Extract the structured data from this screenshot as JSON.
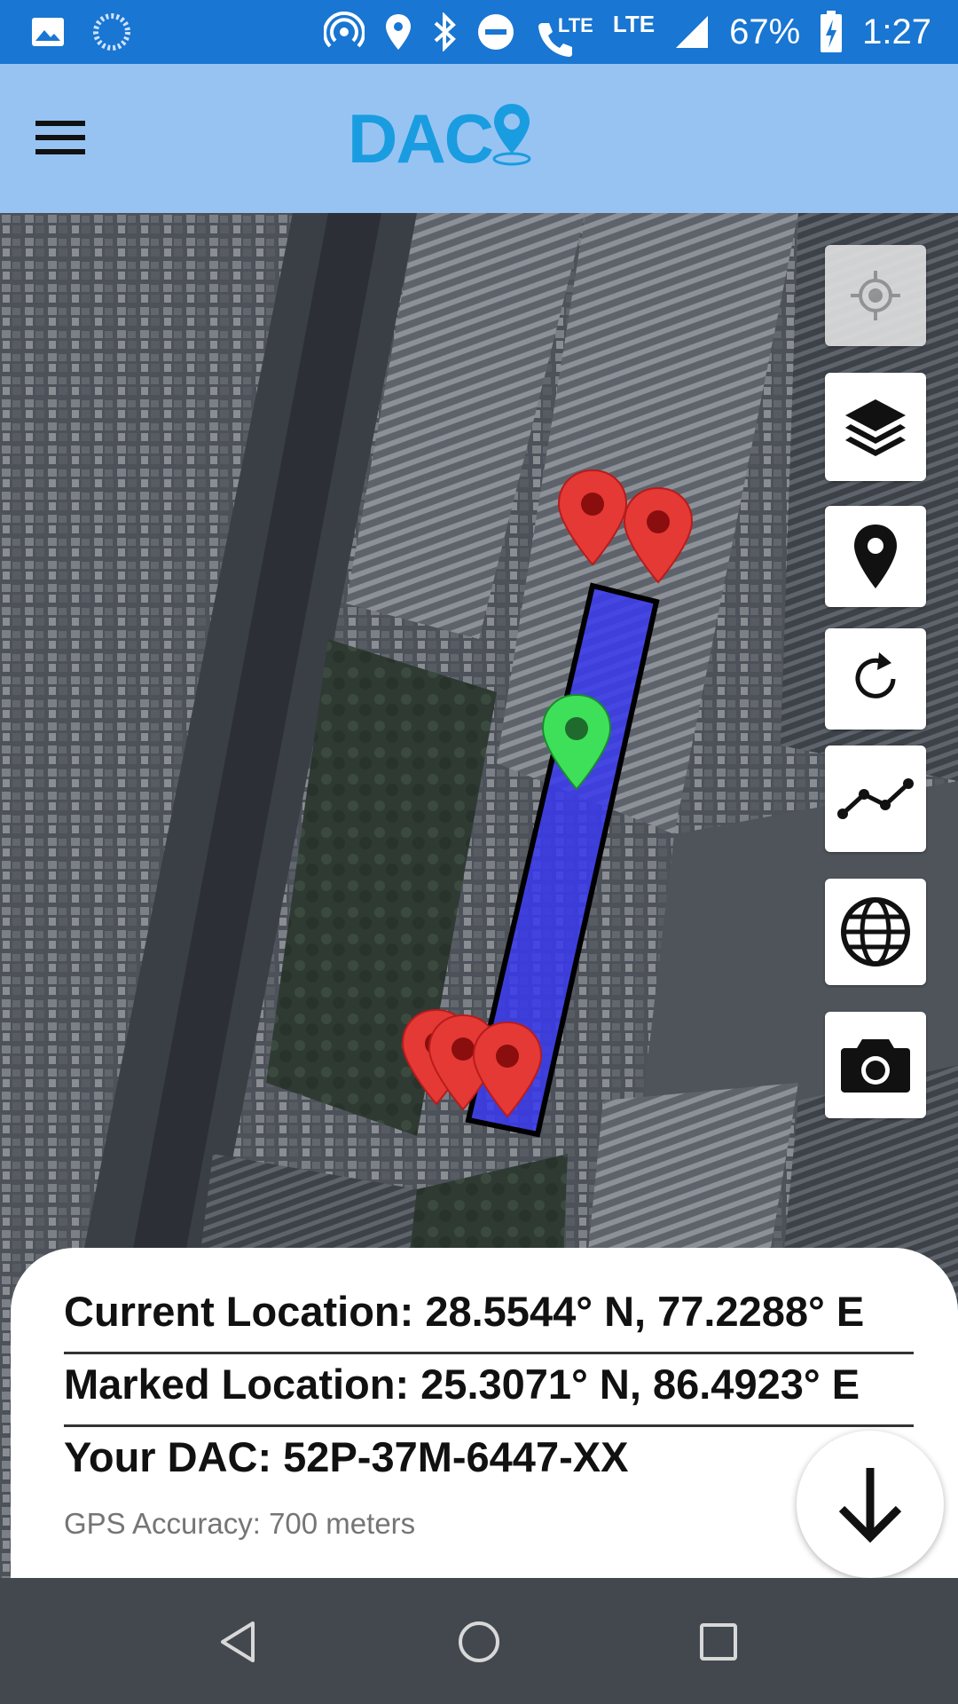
{
  "status_bar": {
    "battery_percent": "67%",
    "time": "1:27",
    "lte_label_1": "LTE",
    "lte_label_2": "LTE",
    "icons": [
      "image-icon",
      "sync-icon",
      "hotspot-icon",
      "location-icon",
      "bluetooth-icon",
      "do-not-disturb-icon",
      "wifi-calling-icon",
      "signal-icon",
      "battery-charging-icon"
    ]
  },
  "app_bar": {
    "logo_text": "DAC",
    "menu_icon": "hamburger-icon"
  },
  "map_controls": [
    {
      "icon": "my-location-icon",
      "enabled": false
    },
    {
      "icon": "layers-icon",
      "enabled": true
    },
    {
      "icon": "place-marker-icon",
      "enabled": true
    },
    {
      "icon": "refresh-icon",
      "enabled": true
    },
    {
      "icon": "polyline-icon",
      "enabled": true
    },
    {
      "icon": "globe-icon",
      "enabled": true
    },
    {
      "icon": "camera-icon",
      "enabled": true
    }
  ],
  "map": {
    "polygon_fill": "#3a3af0",
    "red_marker_color": "#e53935",
    "green_marker_color": "#3ee05a"
  },
  "info": {
    "current_location": "Current Location: 28.5544° N, 77.2288° E",
    "marked_location": "Marked Location: 25.3071° N, 86.4923° E",
    "your_dac": "Your DAC: 52P-37M-6447-XX",
    "gps_accuracy": "GPS Accuracy: 700 meters"
  },
  "fab": {
    "icon": "arrow-down-icon"
  },
  "nav_bar": {
    "icons": [
      "back-icon",
      "home-icon",
      "recents-icon"
    ]
  },
  "colors": {
    "status_bar": "#1976d2",
    "app_bar": "#97c3f2",
    "logo": "#1a9ce0",
    "nav_bar": "#43484f"
  }
}
